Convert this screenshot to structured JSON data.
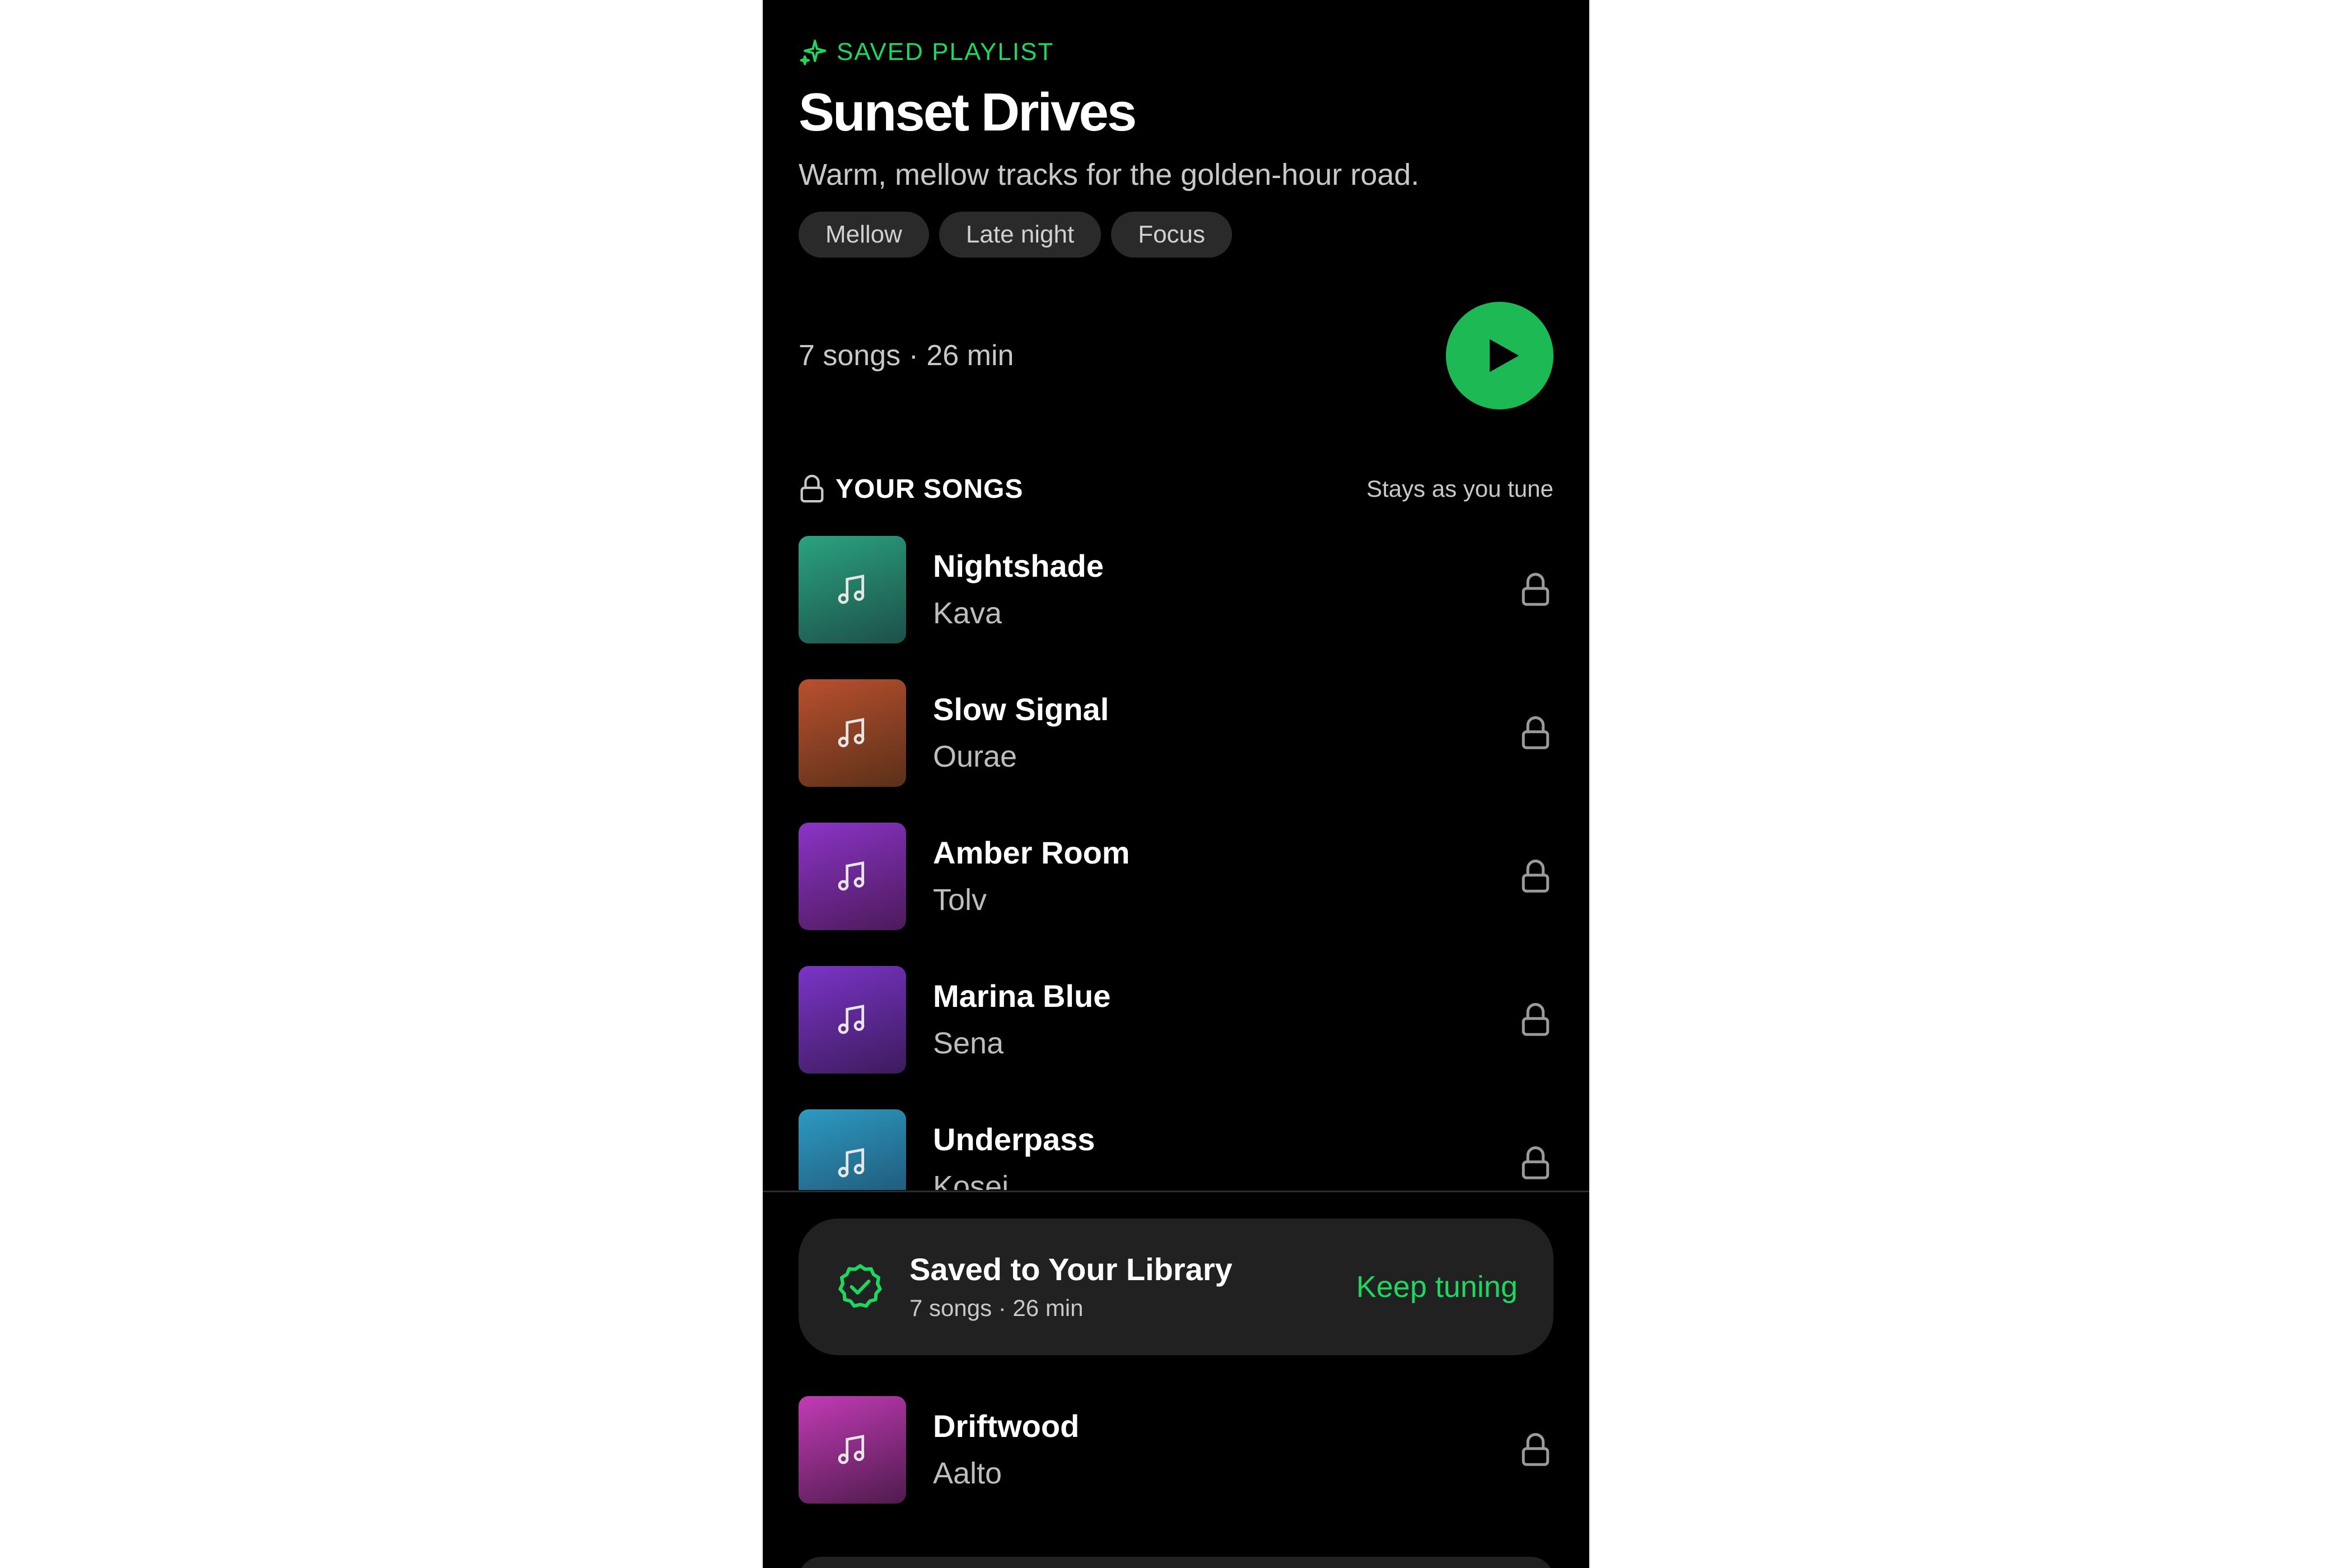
{
  "header": {
    "eyebrow": "SAVED PLAYLIST",
    "eyebrow_icon": "sparkle-icon",
    "title": "Sunset Drives",
    "subtitle": "Warm, mellow tracks for the golden-hour road.",
    "chips": [
      "Mellow",
      "Late night",
      "Focus"
    ]
  },
  "meta": {
    "summary": "7 songs · 26 min",
    "play_icon": "play-icon"
  },
  "section": {
    "title": "YOUR SONGS",
    "note": "Stays as you tune",
    "icon": "lock-icon"
  },
  "songs": [
    {
      "title": "Nightshade",
      "artist": "Kava",
      "art_from": "#2aa37f",
      "art_to": "#1d4f4a"
    },
    {
      "title": "Slow Signal",
      "artist": "Ourae",
      "art_from": "#b9502e",
      "art_to": "#5a3019"
    },
    {
      "title": "Amber Room",
      "artist": "Tolv",
      "art_from": "#8b34c7",
      "art_to": "#4c1a5a"
    },
    {
      "title": "Marina Blue",
      "artist": "Sena",
      "art_from": "#7b34c8",
      "art_to": "#3c1b5c"
    },
    {
      "title": "Underpass",
      "artist": "Kosei",
      "art_from": "#2d9ac2",
      "art_to": "#1e4f6e"
    }
  ],
  "toast": {
    "title": "Saved to Your Library",
    "subtitle": "7 songs · 26 min",
    "action": "Keep tuning",
    "icon": "check-badge-icon"
  },
  "song_after": {
    "title": "Driftwood",
    "artist": "Aalto",
    "art_from": "#c23bb6",
    "art_to": "#4f1b4d"
  },
  "colors": {
    "accent": "#1ed760",
    "play": "#1db954",
    "background": "#000000",
    "surface": "#212121"
  }
}
